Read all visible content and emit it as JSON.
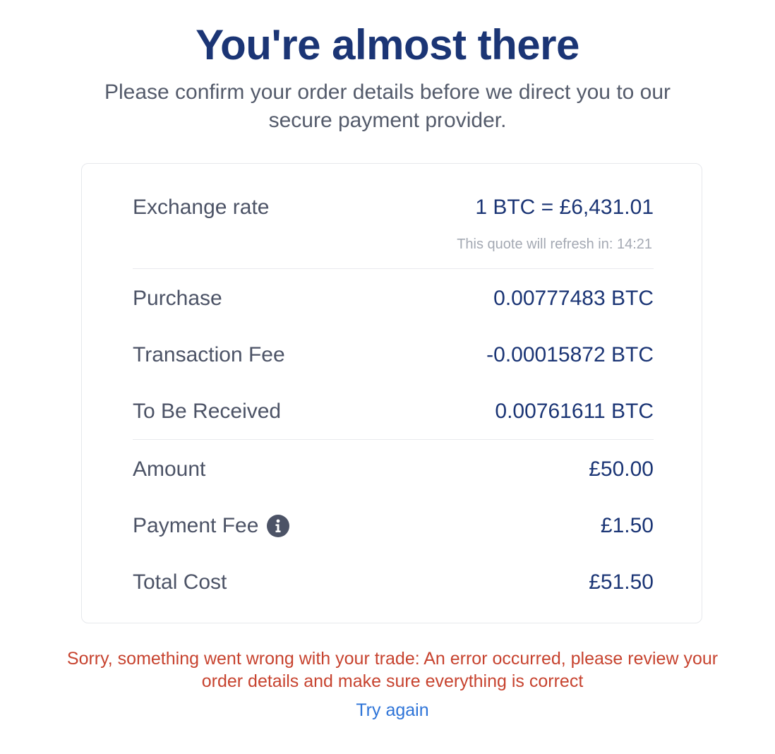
{
  "header": {
    "title": "You're almost there",
    "subtitle": "Please confirm your order details before we direct you to our secure payment provider."
  },
  "summary": {
    "exchange_rate": {
      "label": "Exchange rate",
      "value": "1 BTC = £6,431.01",
      "refresh_text": "This quote will refresh in: 14:21"
    },
    "purchase": {
      "label": "Purchase",
      "value": "0.00777483 BTC"
    },
    "transaction_fee": {
      "label": "Transaction Fee",
      "value": "-0.00015872 BTC"
    },
    "to_be_received": {
      "label": "To Be Received",
      "value": "0.00761611 BTC"
    },
    "amount": {
      "label": "Amount",
      "value": "£50.00"
    },
    "payment_fee": {
      "label": "Payment Fee",
      "value": "£1.50",
      "icon": "info-icon"
    },
    "total_cost": {
      "label": "Total Cost",
      "value": "£51.50"
    }
  },
  "error": {
    "message": "Sorry, something went wrong with your trade: An error occurred, please review your order details and make sure everything is correct",
    "retry_label": "Try again"
  },
  "colors": {
    "title": "#1b3575",
    "value": "#1b3575",
    "label": "#4c5366",
    "error": "#c7432f",
    "link": "#2e74d8"
  }
}
